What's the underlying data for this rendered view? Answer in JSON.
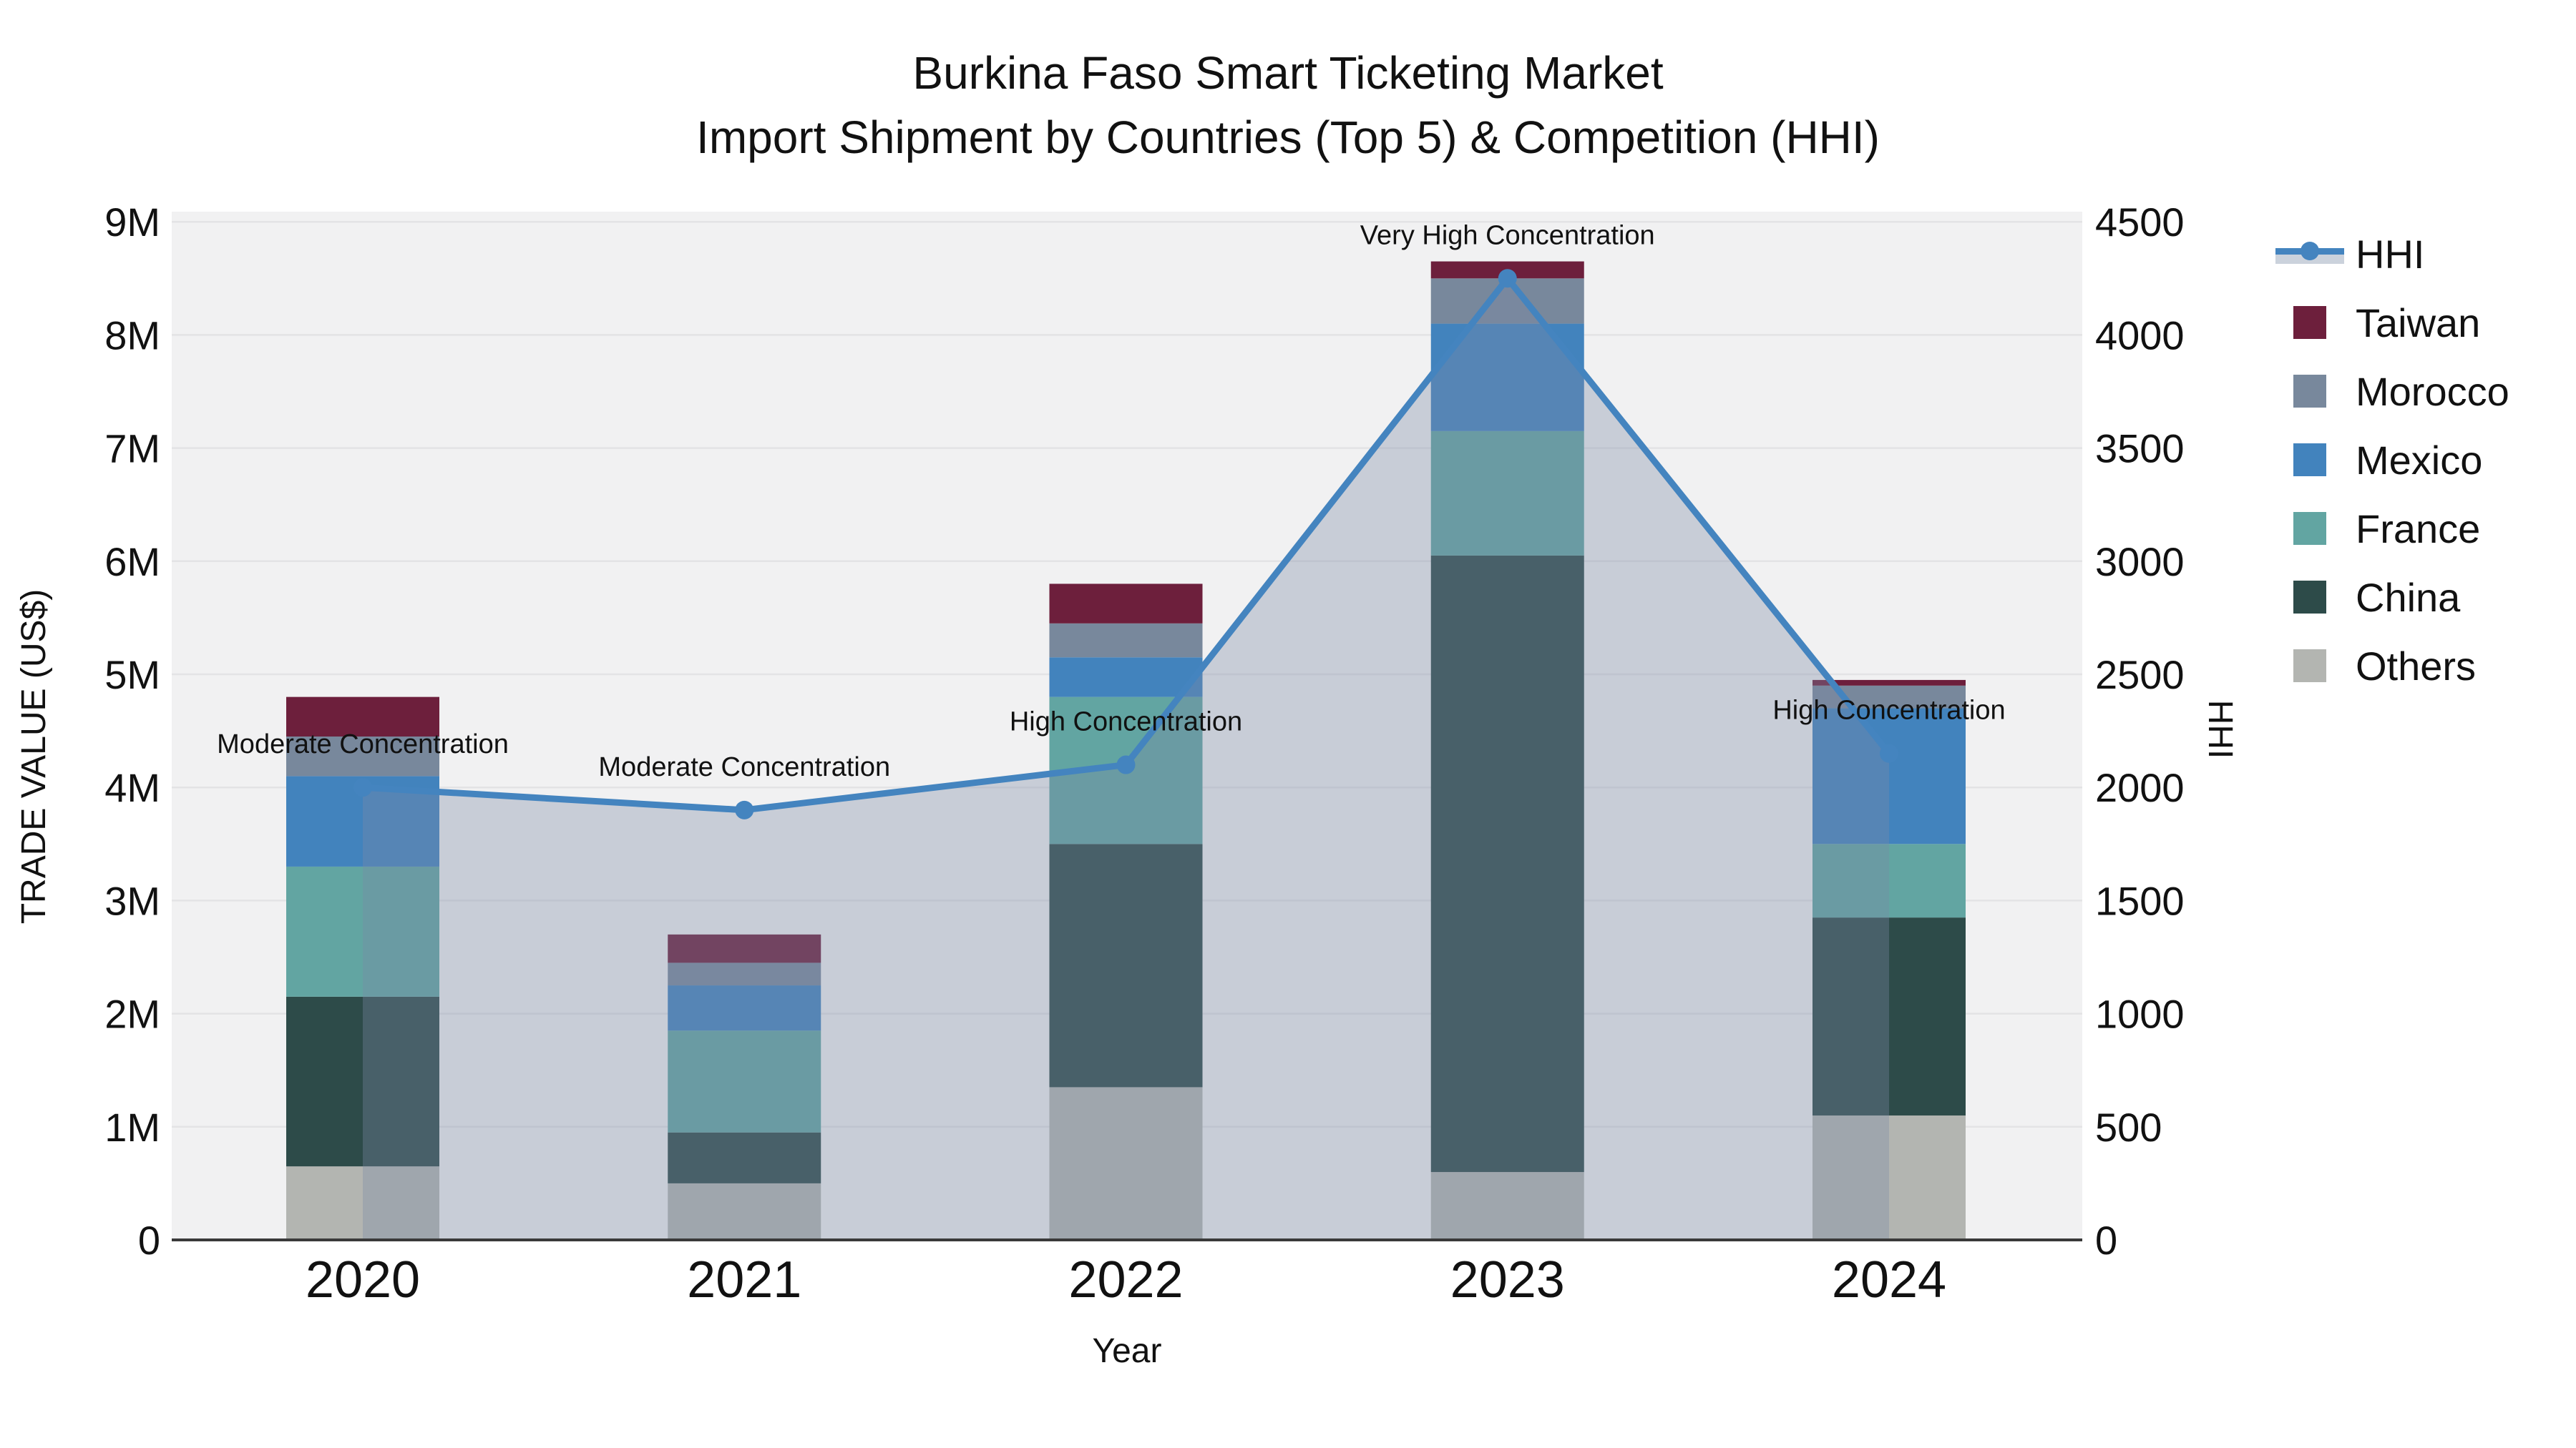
{
  "title": {
    "line1": "Burkina Faso Smart Ticketing Market",
    "line2": "Import Shipment by Countries (Top 5) & Competition (HHI)"
  },
  "axes": {
    "y_left": {
      "title": "TRADE VALUE (US$)",
      "tick_labels": [
        "0",
        "1M",
        "2M",
        "3M",
        "4M",
        "5M",
        "6M",
        "7M",
        "8M",
        "9M"
      ],
      "min": 0,
      "max": 9000000
    },
    "y_right": {
      "title": "HHI",
      "tick_labels": [
        "0",
        "500",
        "1000",
        "1500",
        "2000",
        "2500",
        "3000",
        "3500",
        "4000",
        "4500"
      ],
      "min": 0,
      "max": 4500
    },
    "x": {
      "title": "Year",
      "categories": [
        "2020",
        "2021",
        "2022",
        "2023",
        "2024"
      ]
    }
  },
  "legend": {
    "items": [
      {
        "label": "HHI",
        "type": "line",
        "color": "#4484bf"
      },
      {
        "label": "Taiwan",
        "type": "patch",
        "color": "#6d1f3c"
      },
      {
        "label": "Morocco",
        "type": "patch",
        "color": "#78889c"
      },
      {
        "label": "Mexico",
        "type": "patch",
        "color": "#4283bd"
      },
      {
        "label": "France",
        "type": "patch",
        "color": "#62a5a2"
      },
      {
        "label": "China",
        "type": "patch",
        "color": "#2d4b49"
      },
      {
        "label": "Others",
        "type": "patch",
        "color": "#b3b5b1"
      }
    ]
  },
  "chart_data": {
    "type": "bar",
    "subtype": "stacked-bars-with-line-area-overlay",
    "title": "Burkina Faso Smart Ticketing Market — Import Shipment by Countries (Top 5) & Competition (HHI)",
    "xlabel": "Year",
    "ylabel_left": "TRADE VALUE (US$)",
    "ylabel_right": "HHI",
    "ylim_left": [
      0,
      9000000
    ],
    "ylim_right": [
      0,
      4500
    ],
    "grid": true,
    "legend_position": "right",
    "categories": [
      "2020",
      "2021",
      "2022",
      "2023",
      "2024"
    ],
    "series": [
      {
        "name": "Others",
        "stack_order": 1,
        "color": "#b3b5b1",
        "values": [
          650000,
          500000,
          1350000,
          600000,
          1100000
        ]
      },
      {
        "name": "China",
        "stack_order": 2,
        "color": "#2d4b49",
        "values": [
          1500000,
          450000,
          2150000,
          5450000,
          1750000
        ]
      },
      {
        "name": "France",
        "stack_order": 3,
        "color": "#62a5a2",
        "values": [
          1150000,
          900000,
          1300000,
          1100000,
          650000
        ]
      },
      {
        "name": "Mexico",
        "stack_order": 4,
        "color": "#4283bd",
        "values": [
          800000,
          400000,
          350000,
          950000,
          1200000
        ]
      },
      {
        "name": "Morocco",
        "stack_order": 5,
        "color": "#78889c",
        "values": [
          350000,
          200000,
          300000,
          400000,
          200000
        ]
      },
      {
        "name": "Taiwan",
        "stack_order": 6,
        "color": "#6d1f3c",
        "values": [
          350000,
          250000,
          350000,
          150000,
          50000
        ]
      }
    ],
    "bar_totals": [
      4800000,
      2700000,
      5800000,
      8650000,
      4950000
    ],
    "line_series": {
      "name": "HHI",
      "axis": "right",
      "values": [
        2000,
        1900,
        2100,
        4250,
        2150
      ],
      "line_color": "#4484bf",
      "marker": "circle",
      "area_fill": "rgba(124,138,165,0.35)"
    },
    "annotations": [
      {
        "x": "2020",
        "text": "Moderate Concentration"
      },
      {
        "x": "2021",
        "text": "Moderate Concentration"
      },
      {
        "x": "2022",
        "text": "High Concentration"
      },
      {
        "x": "2023",
        "text": "Very High Concentration"
      },
      {
        "x": "2024",
        "text": "High Concentration"
      }
    ]
  },
  "style": {
    "plot_bg": "#f1f1f2",
    "grid_color": "#e3e3e5",
    "spine_color": "#3a3a3a",
    "text_color": "#111111",
    "legend_hhi_band": "#cbd2dc"
  }
}
